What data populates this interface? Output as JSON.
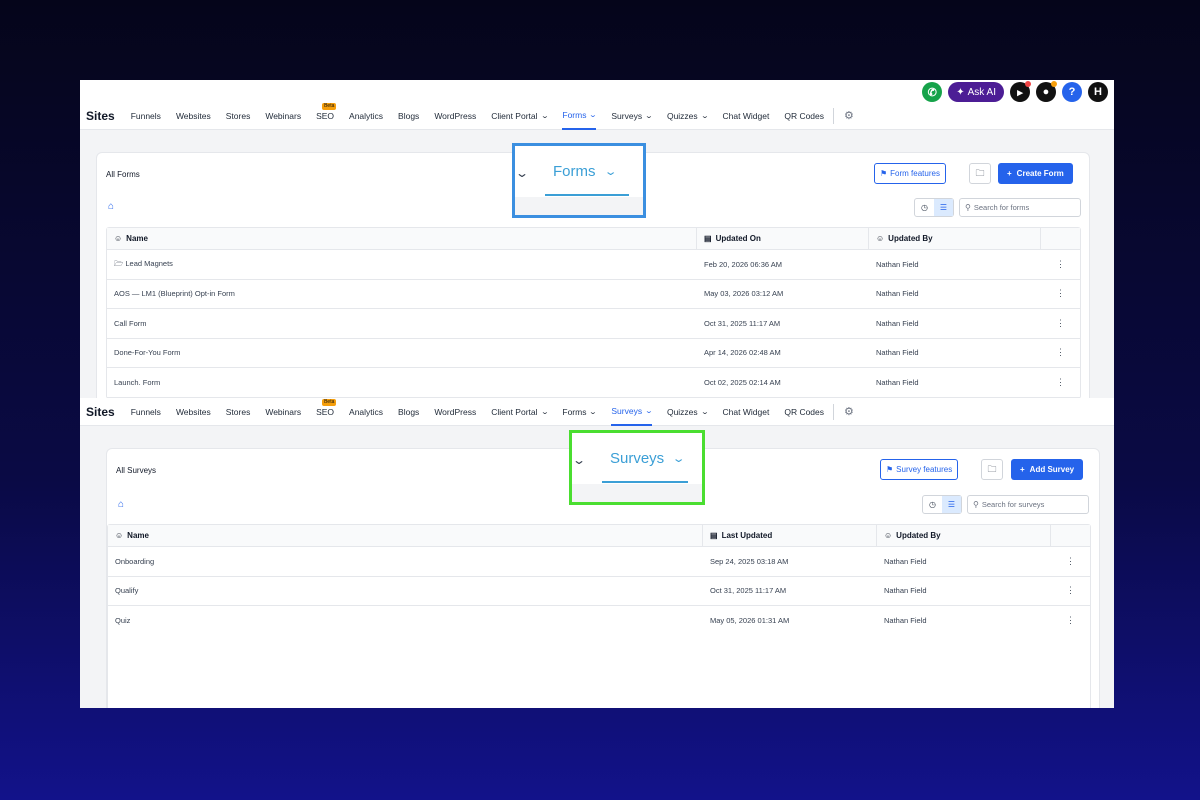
{
  "top_icons": {
    "ask_ai_label": "Ask AI",
    "help_label": "?",
    "avatar_label": "H"
  },
  "nav": {
    "brand": "Sites",
    "items": [
      "Funnels",
      "Websites",
      "Stores",
      "Webinars",
      "SEO",
      "Analytics",
      "Blogs",
      "WordPress",
      "Client Portal",
      "Forms",
      "Surveys",
      "Quizzes",
      "Chat Widget",
      "QR Codes"
    ],
    "beta_label": "Beta"
  },
  "forms_panel": {
    "title": "All Forms",
    "features_label": "Form features",
    "create_label": "Create Form",
    "search_placeholder": "Search for forms",
    "columns": [
      "Name",
      "Updated On",
      "Updated By"
    ],
    "rows": [
      {
        "name": "Lead Magnets",
        "folder": true,
        "updated": "Feb 20, 2026 06:36 AM",
        "by": "Nathan Field"
      },
      {
        "name": "AOS — LM1 (Blueprint) Opt-in Form",
        "folder": false,
        "updated": "May 03, 2026 03:12 AM",
        "by": "Nathan Field"
      },
      {
        "name": "Call Form",
        "folder": false,
        "updated": "Oct 31, 2025 11:17 AM",
        "by": "Nathan Field"
      },
      {
        "name": "Done-For-You Form",
        "folder": false,
        "updated": "Apr 14, 2026 02:48 AM",
        "by": "Nathan Field"
      },
      {
        "name": "Launch. Form",
        "folder": false,
        "updated": "Oct 02, 2025 02:14 AM",
        "by": "Nathan Field"
      }
    ]
  },
  "surveys_panel": {
    "title": "All Surveys",
    "features_label": "Survey features",
    "create_label": "Add Survey",
    "search_placeholder": "Search for surveys",
    "columns": [
      "Name",
      "Last Updated",
      "Updated By"
    ],
    "rows": [
      {
        "name": "Onboarding",
        "updated": "Sep 24, 2025 03:18 AM",
        "by": "Nathan Field"
      },
      {
        "name": "Qualify",
        "updated": "Oct 31, 2025 11:17 AM",
        "by": "Nathan Field"
      },
      {
        "name": "Quiz",
        "updated": "May 05, 2026 01:31 AM",
        "by": "Nathan Field"
      }
    ]
  },
  "callouts": {
    "forms_label": "Forms",
    "surveys_label": "Surveys",
    "forms_border_color": "#3b8fe0",
    "surveys_border_color": "#4ade30"
  },
  "colors": {
    "accent": "#2563eb",
    "background_top": "#05051a",
    "background_bottom": "#12128a"
  }
}
